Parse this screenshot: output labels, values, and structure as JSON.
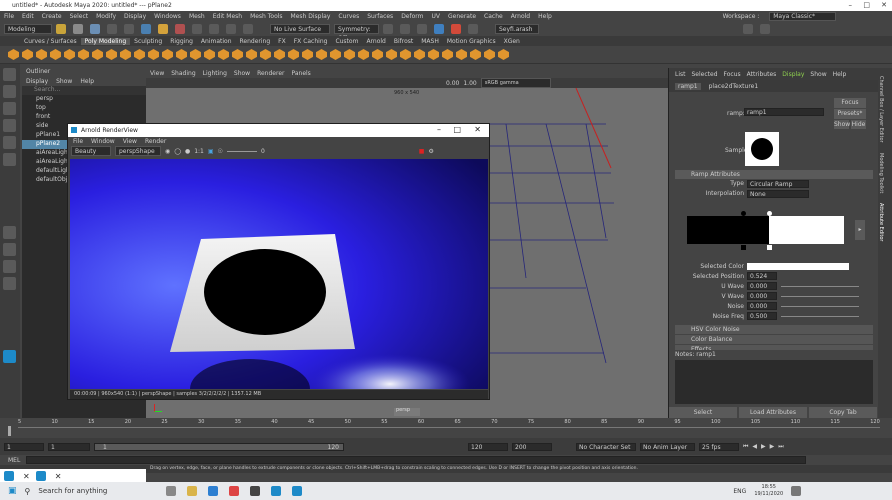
{
  "window": {
    "title": "untitled* - Autodesk Maya 2020: untitled* --- pPlane2"
  },
  "menus": [
    "File",
    "Edit",
    "Create",
    "Select",
    "Modify",
    "Display",
    "Windows",
    "Mesh",
    "Edit Mesh",
    "Mesh Tools",
    "Mesh Display",
    "Curves",
    "Surfaces",
    "Deform",
    "UV",
    "Generate",
    "Cache",
    "Arnold",
    "Help"
  ],
  "workspace": {
    "label": "Workspace :",
    "value": "Maya Classic*"
  },
  "status": {
    "mode": "Modeling",
    "live": "No Live Surface",
    "symmetry": "Symmetry: Off",
    "user": "Seyfi.arash"
  },
  "shelf_tabs": [
    "Curves / Surfaces",
    "Poly Modeling",
    "Sculpting",
    "Rigging",
    "Animation",
    "Rendering",
    "FX",
    "FX Caching",
    "Custom",
    "Arnold",
    "Bifrost",
    "MASH",
    "Motion Graphics",
    "XGen"
  ],
  "outliner": {
    "title": "Outliner",
    "menu": [
      "Display",
      "Show",
      "Help"
    ],
    "search": "Search...",
    "items": [
      "persp",
      "top",
      "front",
      "side",
      "pPlane1",
      "pPlane2",
      "aiAreaLight1",
      "aiAreaLight2",
      "defaultLightSet",
      "defaultObjectSet"
    ]
  },
  "viewport": {
    "menu": [
      "View",
      "Shading",
      "Lighting",
      "Show",
      "Renderer",
      "Panels"
    ],
    "resolution": "960 x 540",
    "camera": "persp",
    "gamma": "sRGB gamma",
    "v1": "0.00",
    "v2": "1.00"
  },
  "renderview": {
    "title": "Arnold RenderView",
    "menu": [
      "File",
      "Window",
      "View",
      "Render"
    ],
    "mode": "Beauty",
    "camera": "perspShape",
    "ratio": "1:1",
    "exposure": "0",
    "status": "00:00:09 | 960x540 (1:1) | perspShape | samples 3/2/2/2/2/2 | 1357.12 MB"
  },
  "ae": {
    "tabs": [
      "List",
      "Selected",
      "Focus",
      "Attributes",
      "Display",
      "Show",
      "Help"
    ],
    "nodes": [
      "ramp1",
      "place2dTexture1"
    ],
    "ramp_label": "ramp:",
    "ramp_name": "ramp1",
    "focus": "Focus",
    "presets": "Presets*",
    "show": "Show",
    "hide": "Hide",
    "sample": "Sample",
    "section": "Ramp Attributes",
    "type_label": "Type",
    "type": "Circular Ramp",
    "interp_label": "Interpolation",
    "interp": "None",
    "sel_color": "Selected Color",
    "sel_pos_label": "Selected Position",
    "sel_pos": "0.524",
    "u_wave": "U Wave",
    "u_wave_v": "0.000",
    "v_wave": "V Wave",
    "v_wave_v": "0.000",
    "noise": "Noise",
    "noise_v": "0.000",
    "noise_freq": "Noise Freq",
    "noise_freq_v": "0.500",
    "hsv": "HSV Color Noise",
    "balance": "Color Balance",
    "effects": "Effects",
    "notes": "Notes: ramp1",
    "select": "Select",
    "load": "Load Attributes",
    "copy": "Copy Tab",
    "side_tabs": [
      "Channel Box / Layer Editor",
      "Modeling Toolkit",
      "Attribute Editor"
    ]
  },
  "time": {
    "ticks": [
      "5",
      "10",
      "15",
      "20",
      "25",
      "30",
      "35",
      "40",
      "45",
      "50",
      "55",
      "60",
      "65",
      "70",
      "75",
      "80",
      "85",
      "90",
      "95",
      "100",
      "105",
      "110",
      "115",
      "120"
    ],
    "start": "1",
    "start2": "1",
    "frame_box": "1",
    "end_inner": "120",
    "end": "120",
    "end2": "200",
    "character": "No Character Set",
    "anim": "No Anim Layer",
    "fps": "25 fps"
  },
  "mel": {
    "label": "MEL"
  },
  "help_line": "Drag on vertex, edge, face, or plane handles to extrude components or clone objects. Ctrl+Shift+LMB+drag to constrain scaling to connected edges. Use D or INSERT to change the pivot position and axis orientation.",
  "taskbar": {
    "search": "Search for anything",
    "time": "18:55",
    "date": "19/11/2020",
    "lang": "ENG"
  }
}
